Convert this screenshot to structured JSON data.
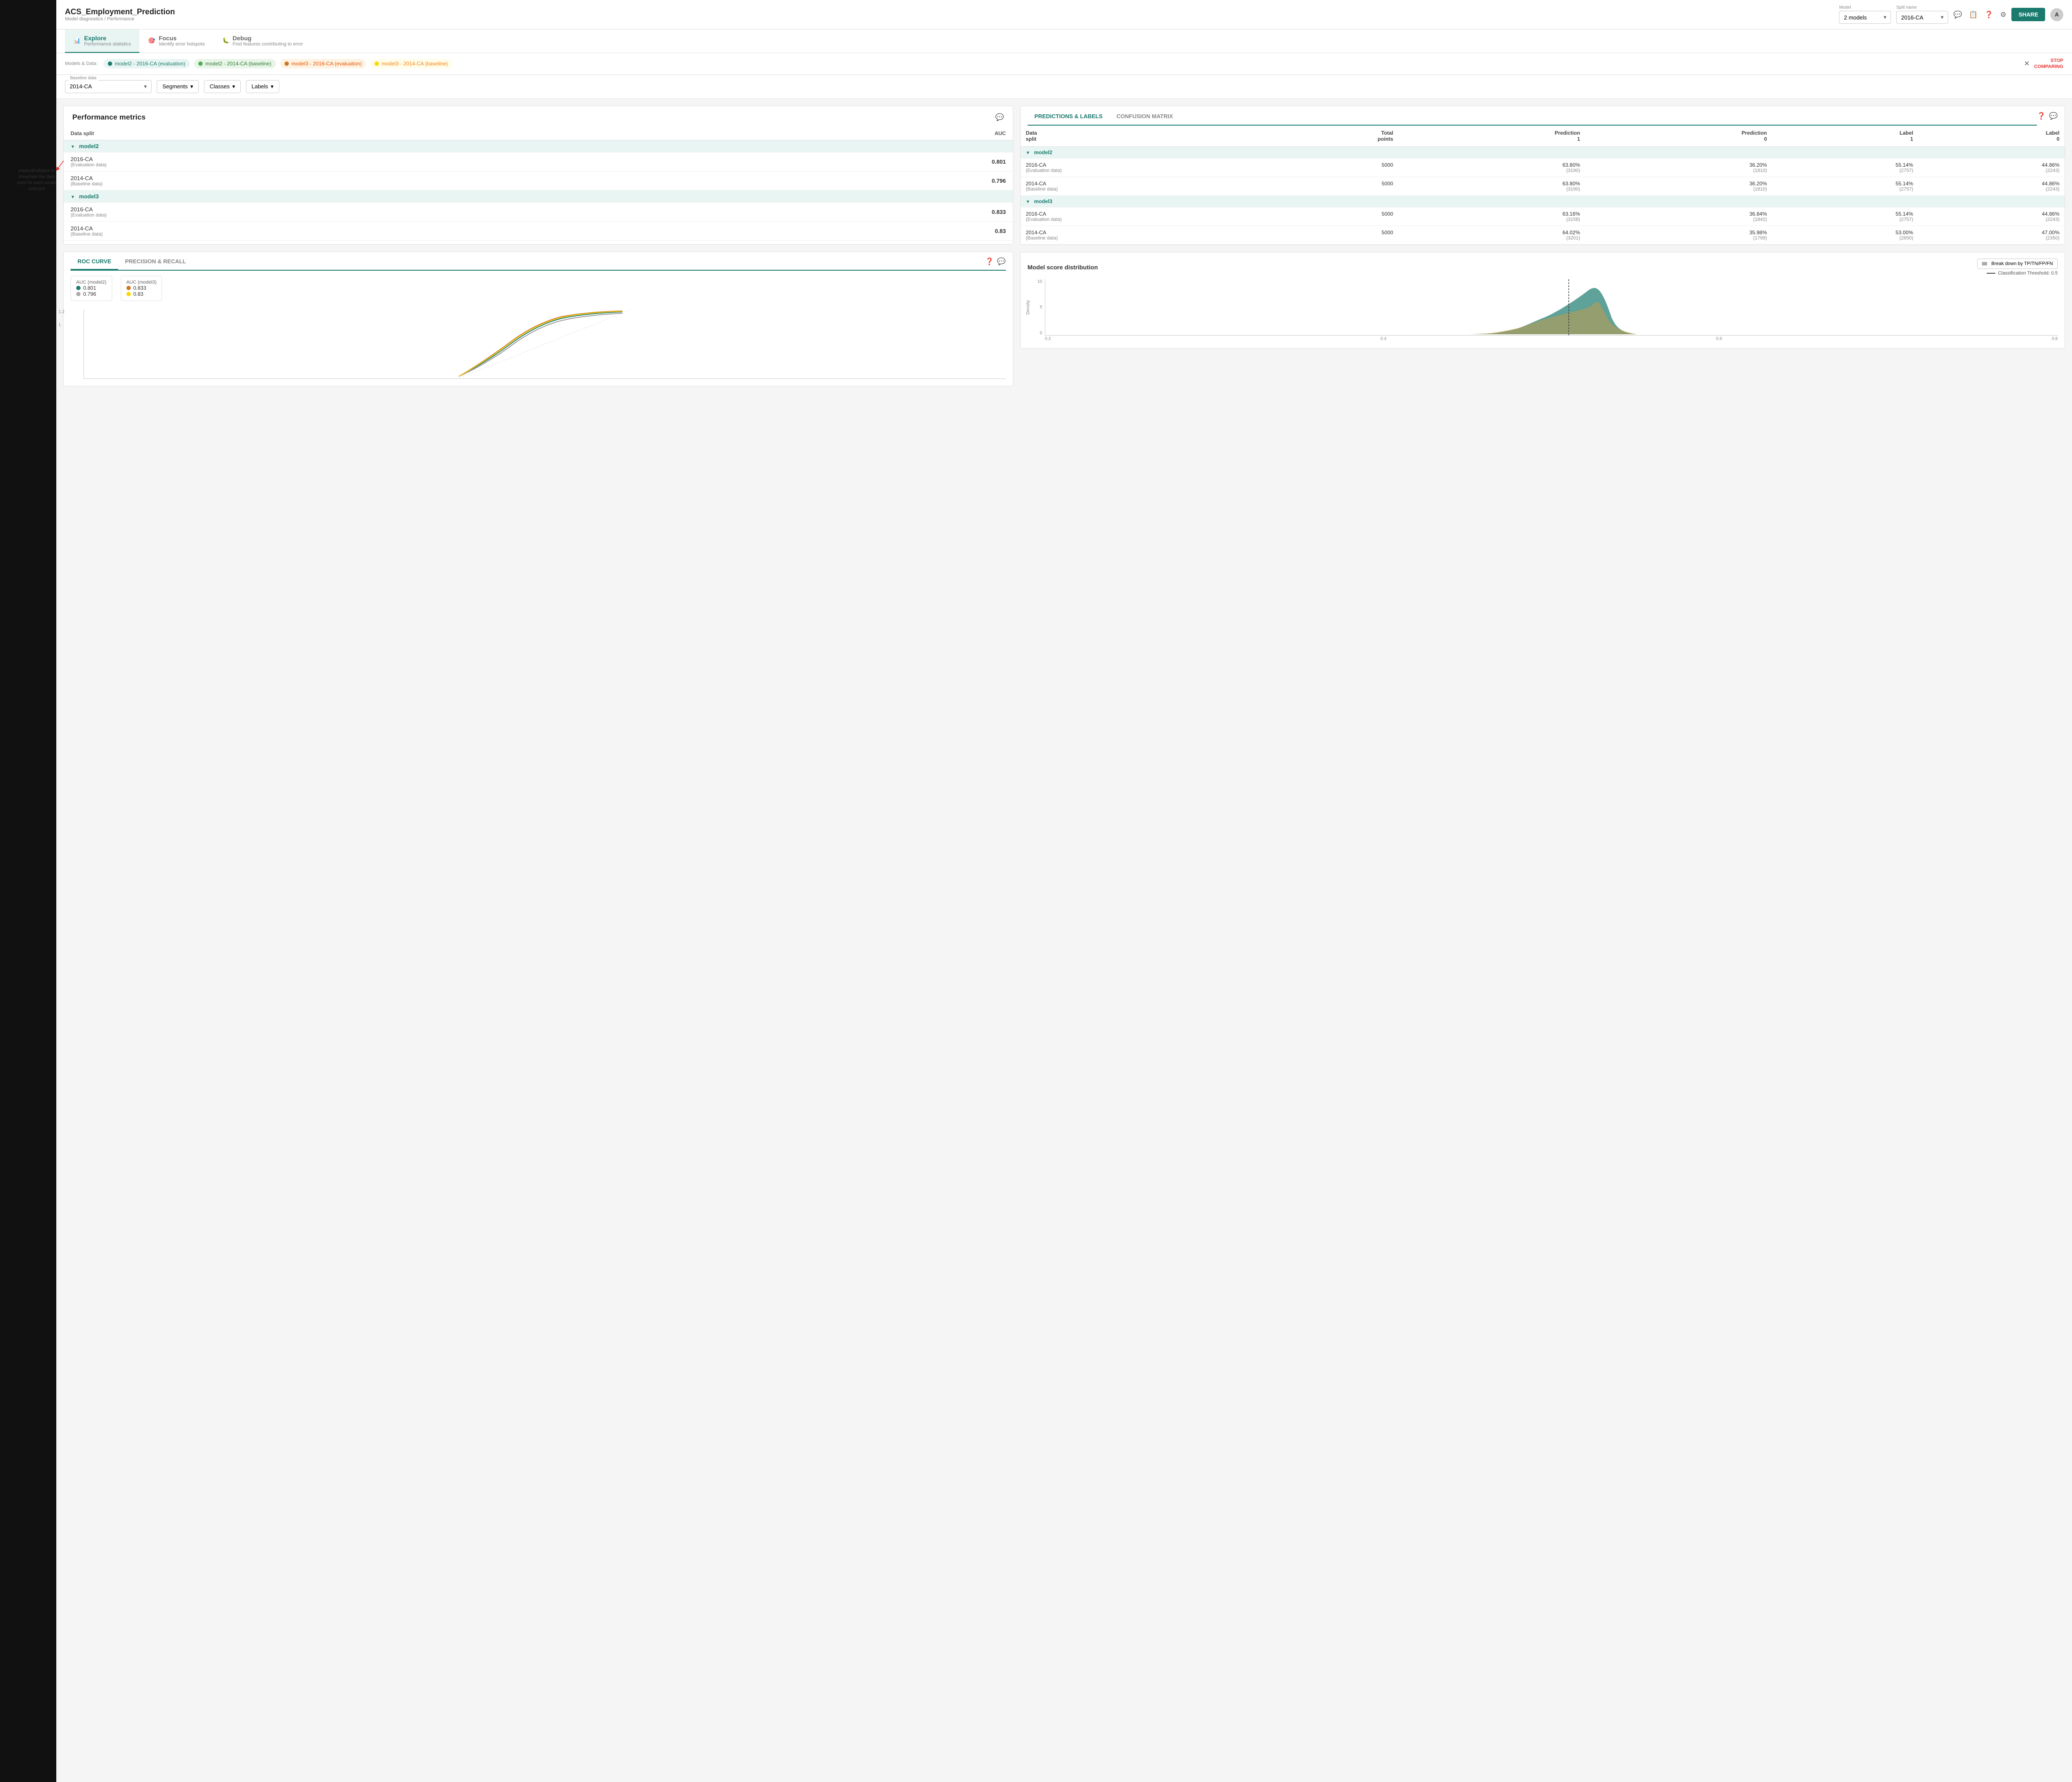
{
  "app": {
    "title": "ACS_Employment_Prediction",
    "subtitle": "Model diagnostics / Performance"
  },
  "header": {
    "model_label": "Model",
    "model_value": "2 models",
    "split_label": "Split name",
    "split_value": "2016-CA",
    "share_btn": "SHARE",
    "avatar": "A"
  },
  "nav": {
    "tabs": [
      {
        "id": "explore",
        "label": "Explore",
        "sub": "Performance statistics",
        "active": true
      },
      {
        "id": "focus",
        "label": "Focus",
        "sub": "Identify error hotspots",
        "active": false
      },
      {
        "id": "debug",
        "label": "Debug",
        "sub": "Find features contributing to error",
        "active": false
      }
    ]
  },
  "models_bar": {
    "label": "Models & Data:",
    "tags": [
      {
        "id": "m2-eval",
        "label": "model2 - 2016-CA (evaluation)",
        "color": "teal",
        "dot": "teal"
      },
      {
        "id": "m2-base",
        "label": "model2 - 2014-CA (baseline)",
        "color": "green",
        "dot": "green"
      },
      {
        "id": "m3-eval",
        "label": "model3 - 2016-CA (evaluation)",
        "color": "orange",
        "dot": "orange"
      },
      {
        "id": "m3-base",
        "label": "model3 - 2014-CA (baseline)",
        "color": "yellow",
        "dot": "yellow"
      }
    ],
    "stop_comparing": "STOP\nCOMPARING"
  },
  "baseline": {
    "label": "Baseline data",
    "value": "2014-CA",
    "segments_btn": "Segments",
    "classes_btn": "Classes",
    "labels_btn": "Labels"
  },
  "performance_metrics": {
    "title": "Performance metrics",
    "table": {
      "col1": "Data split",
      "col2": "AUC",
      "groups": [
        {
          "model": "model2",
          "rows": [
            {
              "split": "2016-CA",
              "sub": "(Evaluation data)",
              "auc": "0.801"
            },
            {
              "split": "2014-CA",
              "sub": "(Baseline data)",
              "auc": "0.796"
            }
          ]
        },
        {
          "model": "model3",
          "rows": [
            {
              "split": "2016-CA",
              "sub": "(Evaluation data)",
              "auc": "0.833"
            },
            {
              "split": "2014-CA",
              "sub": "(Baseline data)",
              "auc": "0.83"
            }
          ]
        }
      ]
    }
  },
  "annotation": {
    "text": "expand/collapse to show/hide the data used for each model selected"
  },
  "roc_curve": {
    "tabs": [
      "ROC CURVE",
      "PRECISION & RECALL"
    ],
    "active_tab": "ROC CURVE",
    "legend": {
      "group1_title": "AUC (model2)",
      "group1_items": [
        {
          "color": "#1a7a6e",
          "value": "0.801"
        },
        {
          "color": "#aaa",
          "value": "0.796"
        }
      ],
      "group2_title": "AUC (model3)",
      "group2_items": [
        {
          "color": "#cc7722",
          "value": "0.833"
        },
        {
          "color": "#ffd600",
          "value": "0.83"
        }
      ]
    },
    "y_vals": [
      "1.2",
      "1"
    ],
    "chart_note": "ROC chart"
  },
  "predictions": {
    "tabs": [
      "PREDICTIONS & LABELS",
      "CONFUSION MATRIX"
    ],
    "active_tab": "PREDICTIONS & LABELS",
    "columns": [
      "Data split",
      "Total points",
      "Prediction 1",
      "Prediction 0",
      "Label 1",
      "Label 0"
    ],
    "groups": [
      {
        "model": "model2",
        "rows": [
          {
            "split": "2016-CA",
            "split_sub": "(Evaluation data)",
            "total": "5000",
            "pred1_pct": "63.80%",
            "pred1_cnt": "(3190)",
            "pred0_pct": "36.20%",
            "pred0_cnt": "(1810)",
            "lbl1_pct": "55.14%",
            "lbl1_cnt": "(2757)",
            "lbl0_pct": "44.86%",
            "lbl0_cnt": "(2243)"
          },
          {
            "split": "2014-CA",
            "split_sub": "(Baseline data)",
            "total": "5000",
            "pred1_pct": "63.80%",
            "pred1_cnt": "(3190)",
            "pred0_pct": "36.20%",
            "pred0_cnt": "(1810)",
            "lbl1_pct": "55.14%",
            "lbl1_cnt": "(2757)",
            "lbl0_pct": "44.86%",
            "lbl0_cnt": "(2243)"
          }
        ]
      },
      {
        "model": "model3",
        "rows": [
          {
            "split": "2016-CA",
            "split_sub": "(Evaluation data)",
            "total": "5000",
            "pred1_pct": "63.16%",
            "pred1_cnt": "(3158)",
            "pred0_pct": "36.84%",
            "pred0_cnt": "(1842)",
            "lbl1_pct": "55.14%",
            "lbl1_cnt": "(2757)",
            "lbl0_pct": "44.86%",
            "lbl0_cnt": "(2243)"
          },
          {
            "split": "2014-CA",
            "split_sub": "(Baseline data)",
            "total": "5000",
            "pred1_pct": "64.02%",
            "pred1_cnt": "(3201)",
            "pred0_pct": "35.98%",
            "pred0_cnt": "(1799)",
            "lbl1_pct": "53.00%",
            "lbl1_cnt": "(2650)",
            "lbl0_pct": "47.00%",
            "lbl0_cnt": "(2350)"
          }
        ]
      }
    ]
  },
  "distribution": {
    "title": "Model score distribution",
    "breakdown_btn": "Break down by TP/TN/FP/FN",
    "threshold_label": "Classification Threshold: 0.5",
    "y_vals": [
      "10",
      "5"
    ],
    "x_vals": [
      "0.2",
      "0.4",
      "0.6",
      "0.8"
    ]
  }
}
